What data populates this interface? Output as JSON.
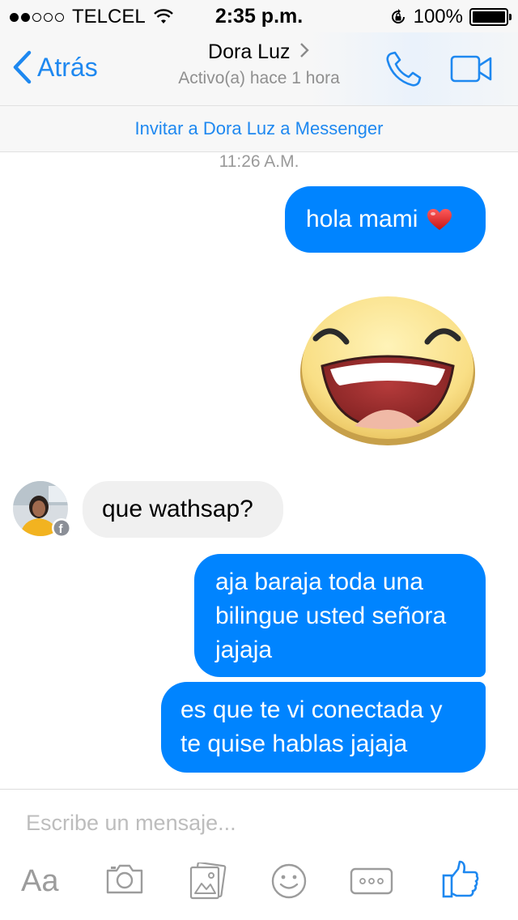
{
  "status_bar": {
    "carrier": "TELCEL",
    "time": "2:35 p.m.",
    "battery": "100%"
  },
  "nav": {
    "back_label": "Atrás",
    "contact_name": "Dora Luz",
    "contact_status": "Activo(a) hace 1 hora"
  },
  "invite": {
    "label": "Invitar a Dora Luz a Messenger"
  },
  "conversation": {
    "timestamp": "11:26 A.M.",
    "messages": [
      {
        "direction": "out",
        "text": "hola mami"
      },
      {
        "direction": "out",
        "text": ""
      },
      {
        "direction": "in",
        "text": "que wathsap?"
      },
      {
        "direction": "out",
        "text": "aja baraja toda una bilingue usted señora jajaja"
      },
      {
        "direction": "out",
        "text": "es que te vi conectada y te quise hablas jajaja"
      }
    ]
  },
  "composer": {
    "placeholder": "Escribe un mensaje...",
    "text_tool_label": "Aa"
  },
  "colors": {
    "accent": "#1e88f0",
    "outgoing_bubble": "#0084ff",
    "incoming_bubble": "#f0f0f0"
  }
}
